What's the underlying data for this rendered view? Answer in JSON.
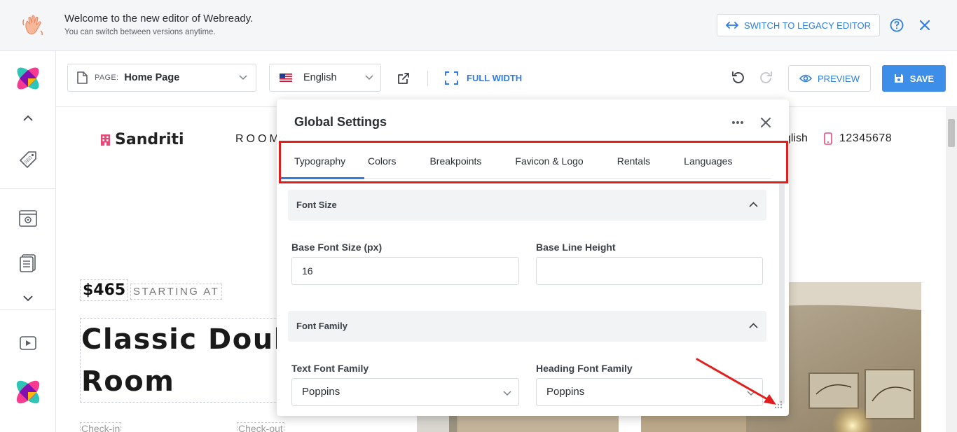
{
  "banner": {
    "title": "Welcome to the new editor of Webready.",
    "subtitle": "You can switch between versions anytime.",
    "switch_button": "SWITCH TO LEGACY EDITOR",
    "icons": [
      "wave-hand-icon",
      "help-icon",
      "close-icon"
    ]
  },
  "toolbar": {
    "page_label": "PAGE:",
    "page_value": "Home Page",
    "language_value": "English",
    "full_width_label": "FULL WIDTH",
    "preview_label": "PREVIEW",
    "save_label": "SAVE",
    "accent_color": "#2f7de1",
    "save_color": "#3d8ee8"
  },
  "sidebar": {
    "icons": [
      "app-logo-icon",
      "chevron-up-icon",
      "seo-tag-icon",
      "site-settings-icon",
      "pages-list-icon",
      "chevron-down-icon",
      "video-tutorial-icon",
      "app-logo-icon"
    ]
  },
  "site_preview": {
    "brand": "Sandriti",
    "nav_rooms": "ROOM",
    "nav_language": "glish",
    "nav_phone": "12345678",
    "price": "$465",
    "starting_at": "STARTING AT",
    "title_line1": "Classic Doub",
    "title_line2": "Room",
    "check_in": "Check-in",
    "check_out": "Check-out",
    "brand_color": "#e84a78"
  },
  "dialog": {
    "title": "Global Settings",
    "tabs": [
      "Typography",
      "Colors",
      "Breakpoints",
      "Favicon & Logo",
      "Rentals",
      "Languages"
    ],
    "active_tab": "Typography",
    "font_size_section": {
      "heading": "Font Size",
      "base_font_size_label": "Base Font Size (px)",
      "base_font_size_value": "16",
      "base_line_height_label": "Base Line Height",
      "base_line_height_value": ""
    },
    "font_family_section": {
      "heading": "Font Family",
      "text_font_label": "Text Font Family",
      "text_font_value": "Poppins",
      "heading_font_label": "Heading Font Family",
      "heading_font_value": "Poppins"
    }
  },
  "annotations": {
    "highlight_color": "#e01e1e"
  }
}
